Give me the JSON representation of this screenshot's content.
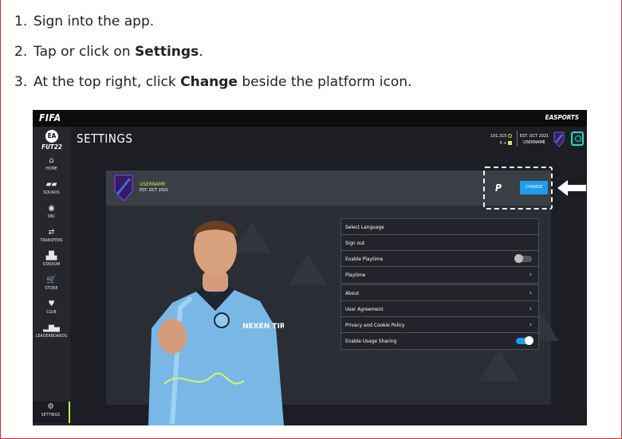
{
  "steps": [
    {
      "num": "1.",
      "pre": "Sign into the app.",
      "bold": "",
      "post": ""
    },
    {
      "num": "2.",
      "pre": "Tap or click on ",
      "bold": "Settings",
      "post": "."
    },
    {
      "num": "3.",
      "pre": "At the top right, click ",
      "bold": "Change",
      "post": " beside the platform icon."
    }
  ],
  "game": {
    "logo": "FIFA",
    "publisher": "EASPORTS",
    "brand": "FUT22",
    "brand_badge": "EA",
    "header_title": "SETTINGS",
    "coins": "101,315",
    "points": "0",
    "header_est": "EST. OCT 2021",
    "header_user": "USERNAME",
    "profile_name": "USERNAME",
    "profile_est": "EST. OCT 2021",
    "change_label": "CHANGE",
    "platform_icon": "playstation-icon",
    "nav": [
      {
        "label": "HOME",
        "icon": "⌂"
      },
      {
        "label": "SQUADS",
        "icon": "▰▰"
      },
      {
        "label": "SBC",
        "icon": "◉"
      },
      {
        "label": "TRANSFERS",
        "icon": "⇄"
      },
      {
        "label": "STADIUM",
        "icon": "▟▙"
      },
      {
        "label": "STORE",
        "icon": "🛒"
      },
      {
        "label": "CLUB",
        "icon": "♥"
      },
      {
        "label": "LEADERBOARDS",
        "icon": "▂▆▄"
      },
      {
        "label": "SETTINGS",
        "icon": "⚙"
      }
    ],
    "menu1": [
      {
        "label": "Select Language",
        "control": "none"
      },
      {
        "label": "Sign out",
        "control": "none"
      },
      {
        "label": "Enable Playtime",
        "control": "toggle-off"
      },
      {
        "label": "Playtime",
        "control": "chevron"
      }
    ],
    "menu2": [
      {
        "label": "About",
        "control": "chevron"
      },
      {
        "label": "User Agreement",
        "control": "chevron"
      },
      {
        "label": "Privacy and Cookie Policy",
        "control": "chevron"
      },
      {
        "label": "Enable Usage Sharing",
        "control": "toggle-on"
      }
    ],
    "jersey_sponsor": "NEXEN TIRE",
    "colors": {
      "accent": "#c9ee4d",
      "button": "#1e9cf0",
      "frame": "#d32f2f"
    }
  }
}
